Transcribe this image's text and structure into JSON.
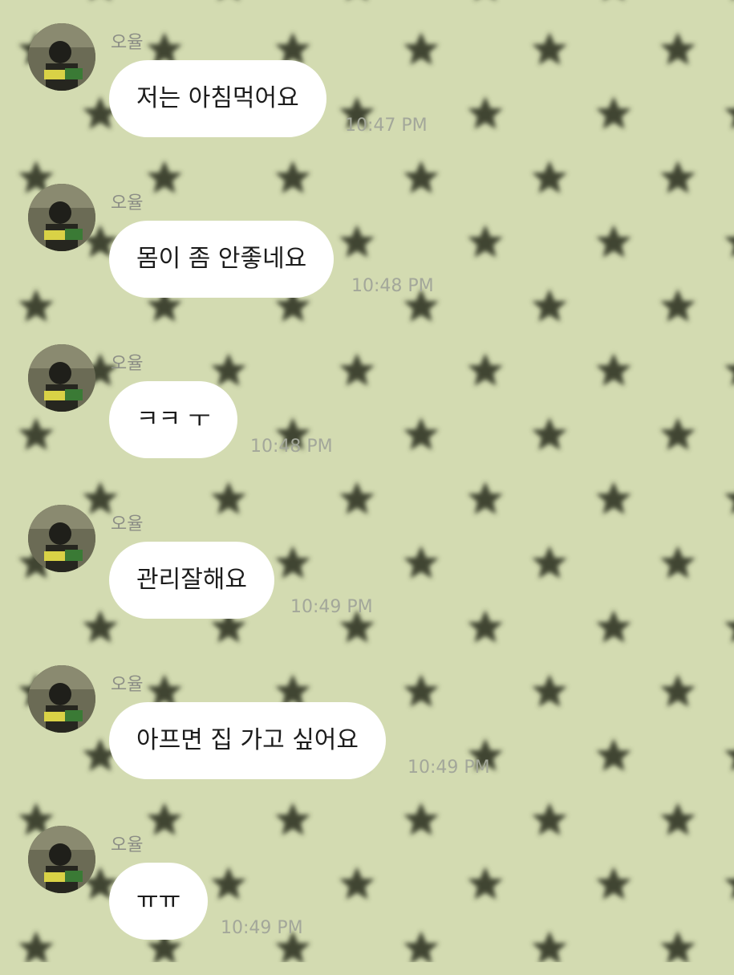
{
  "chat": {
    "messages": [
      {
        "sender": "오율",
        "text": "저는 아침먹어요",
        "time": "10:47 PM"
      },
      {
        "sender": "오율",
        "text": "몸이 좀 안좋네요",
        "time": "10:48 PM"
      },
      {
        "sender": "오율",
        "text": "ㅋㅋ ㅜ",
        "time": "10:48 PM"
      },
      {
        "sender": "오율",
        "text": "관리잘해요",
        "time": "10:49 PM"
      },
      {
        "sender": "오율",
        "text": "아프면 집 가고 싶어요",
        "time": "10:49 PM"
      },
      {
        "sender": "오율",
        "text": "ㅠㅠ",
        "time": "10:49 PM"
      }
    ]
  },
  "colors": {
    "background": "#d3dbb1",
    "star": "#3f4530",
    "bubble": "#ffffff",
    "sender_text": "#8c8e86",
    "time_text": "#a3a79a"
  },
  "icons": {
    "wallpaper": "star-pattern",
    "avatar": "profile-photo"
  }
}
